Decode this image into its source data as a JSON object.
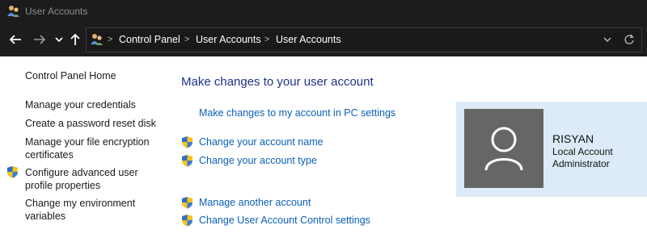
{
  "window": {
    "title": "User Accounts"
  },
  "nav": {
    "breadcrumb": [
      "Control Panel",
      "User Accounts",
      "User Accounts"
    ]
  },
  "sidebar": {
    "home": "Control Panel Home",
    "links": [
      "Manage your credentials",
      "Create a password reset disk",
      "Manage your file encryption certificates",
      "Configure advanced user profile properties",
      "Change my environment variables"
    ]
  },
  "main": {
    "heading": "Make changes to your user account",
    "pc_settings_link": "Make changes to my account in PC settings",
    "change_name": "Change your account name",
    "change_type": "Change your account type",
    "manage_another": "Manage another account",
    "uac_settings": "Change User Account Control settings"
  },
  "account": {
    "name": "RISYAN",
    "type": "Local Account",
    "role": "Administrator"
  },
  "colors": {
    "link": "#0a60b6",
    "heading": "#1e3287",
    "card_bg": "#dcebf7",
    "titlebar_bg": "#1c1c1c"
  },
  "icons": [
    "users-icon",
    "back-arrow-icon",
    "forward-arrow-icon",
    "chevron-down-icon",
    "up-arrow-icon",
    "refresh-icon",
    "uac-shield-icon",
    "user-avatar-icon"
  ]
}
